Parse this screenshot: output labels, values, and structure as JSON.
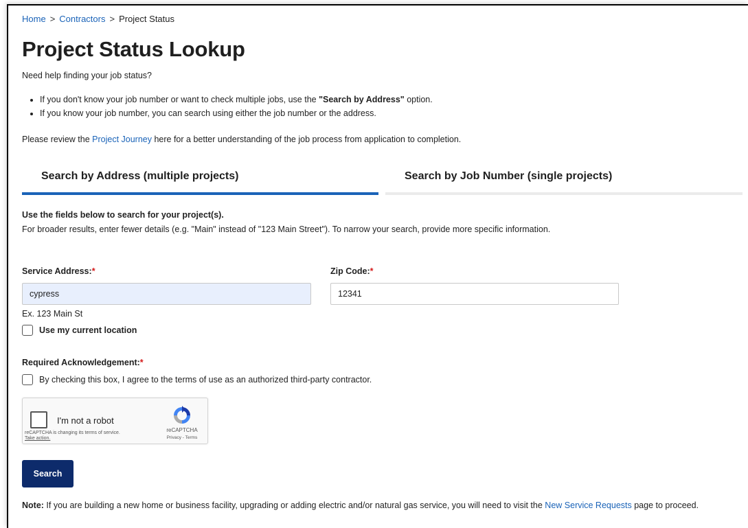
{
  "breadcrumb": {
    "home": "Home",
    "sep": ">",
    "contractors": "Contractors",
    "current": "Project Status"
  },
  "page": {
    "title": "Project Status Lookup",
    "help": "Need help finding your job status?",
    "tip1_pre": "If you don't know your job number or want to check multiple jobs, use the ",
    "tip1_bold": "\"Search by Address\"",
    "tip1_post": " option.",
    "tip2": "If you know your job number, you can search using either the job number or the address.",
    "journey_pre": "Please review the ",
    "journey_link": "Project Journey",
    "journey_post": " here for a better understanding of the job process from application to completion."
  },
  "tabs": {
    "address": "Search by Address (multiple projects)",
    "job": "Search by Job Number (single projects)",
    "active_color": "#1a63b8"
  },
  "form": {
    "intro1": "Use the fields below to search for your project(s).",
    "intro2": "For broader results, enter fewer details (e.g. \"Main\" instead of \"123 Main Street\"). To narrow your search, provide more specific information.",
    "address_label": "Service Address:",
    "address_value": "cypress",
    "address_hint": "Ex. 123 Main St",
    "zip_label": "Zip Code:",
    "zip_value": "12341",
    "required_mark": "*",
    "location_label": "Use my current location",
    "ack_label": "Required Acknowledgement:",
    "ack_text": "By checking this box, I agree to the terms of use as an authorized third-party contractor."
  },
  "captcha": {
    "label": "I'm not a robot",
    "notice": "reCAPTCHA is changing its terms of service.",
    "take_action": "Take action.",
    "brand": "reCAPTCHA",
    "terms": "Privacy - Terms"
  },
  "search_button": "Search",
  "note": {
    "bold": "Note:",
    "text": " If you are building a new home or business facility, upgrading or adding electric and/or natural gas service, you will need to visit the ",
    "link": "New Service Requests",
    "post": " page to proceed."
  }
}
